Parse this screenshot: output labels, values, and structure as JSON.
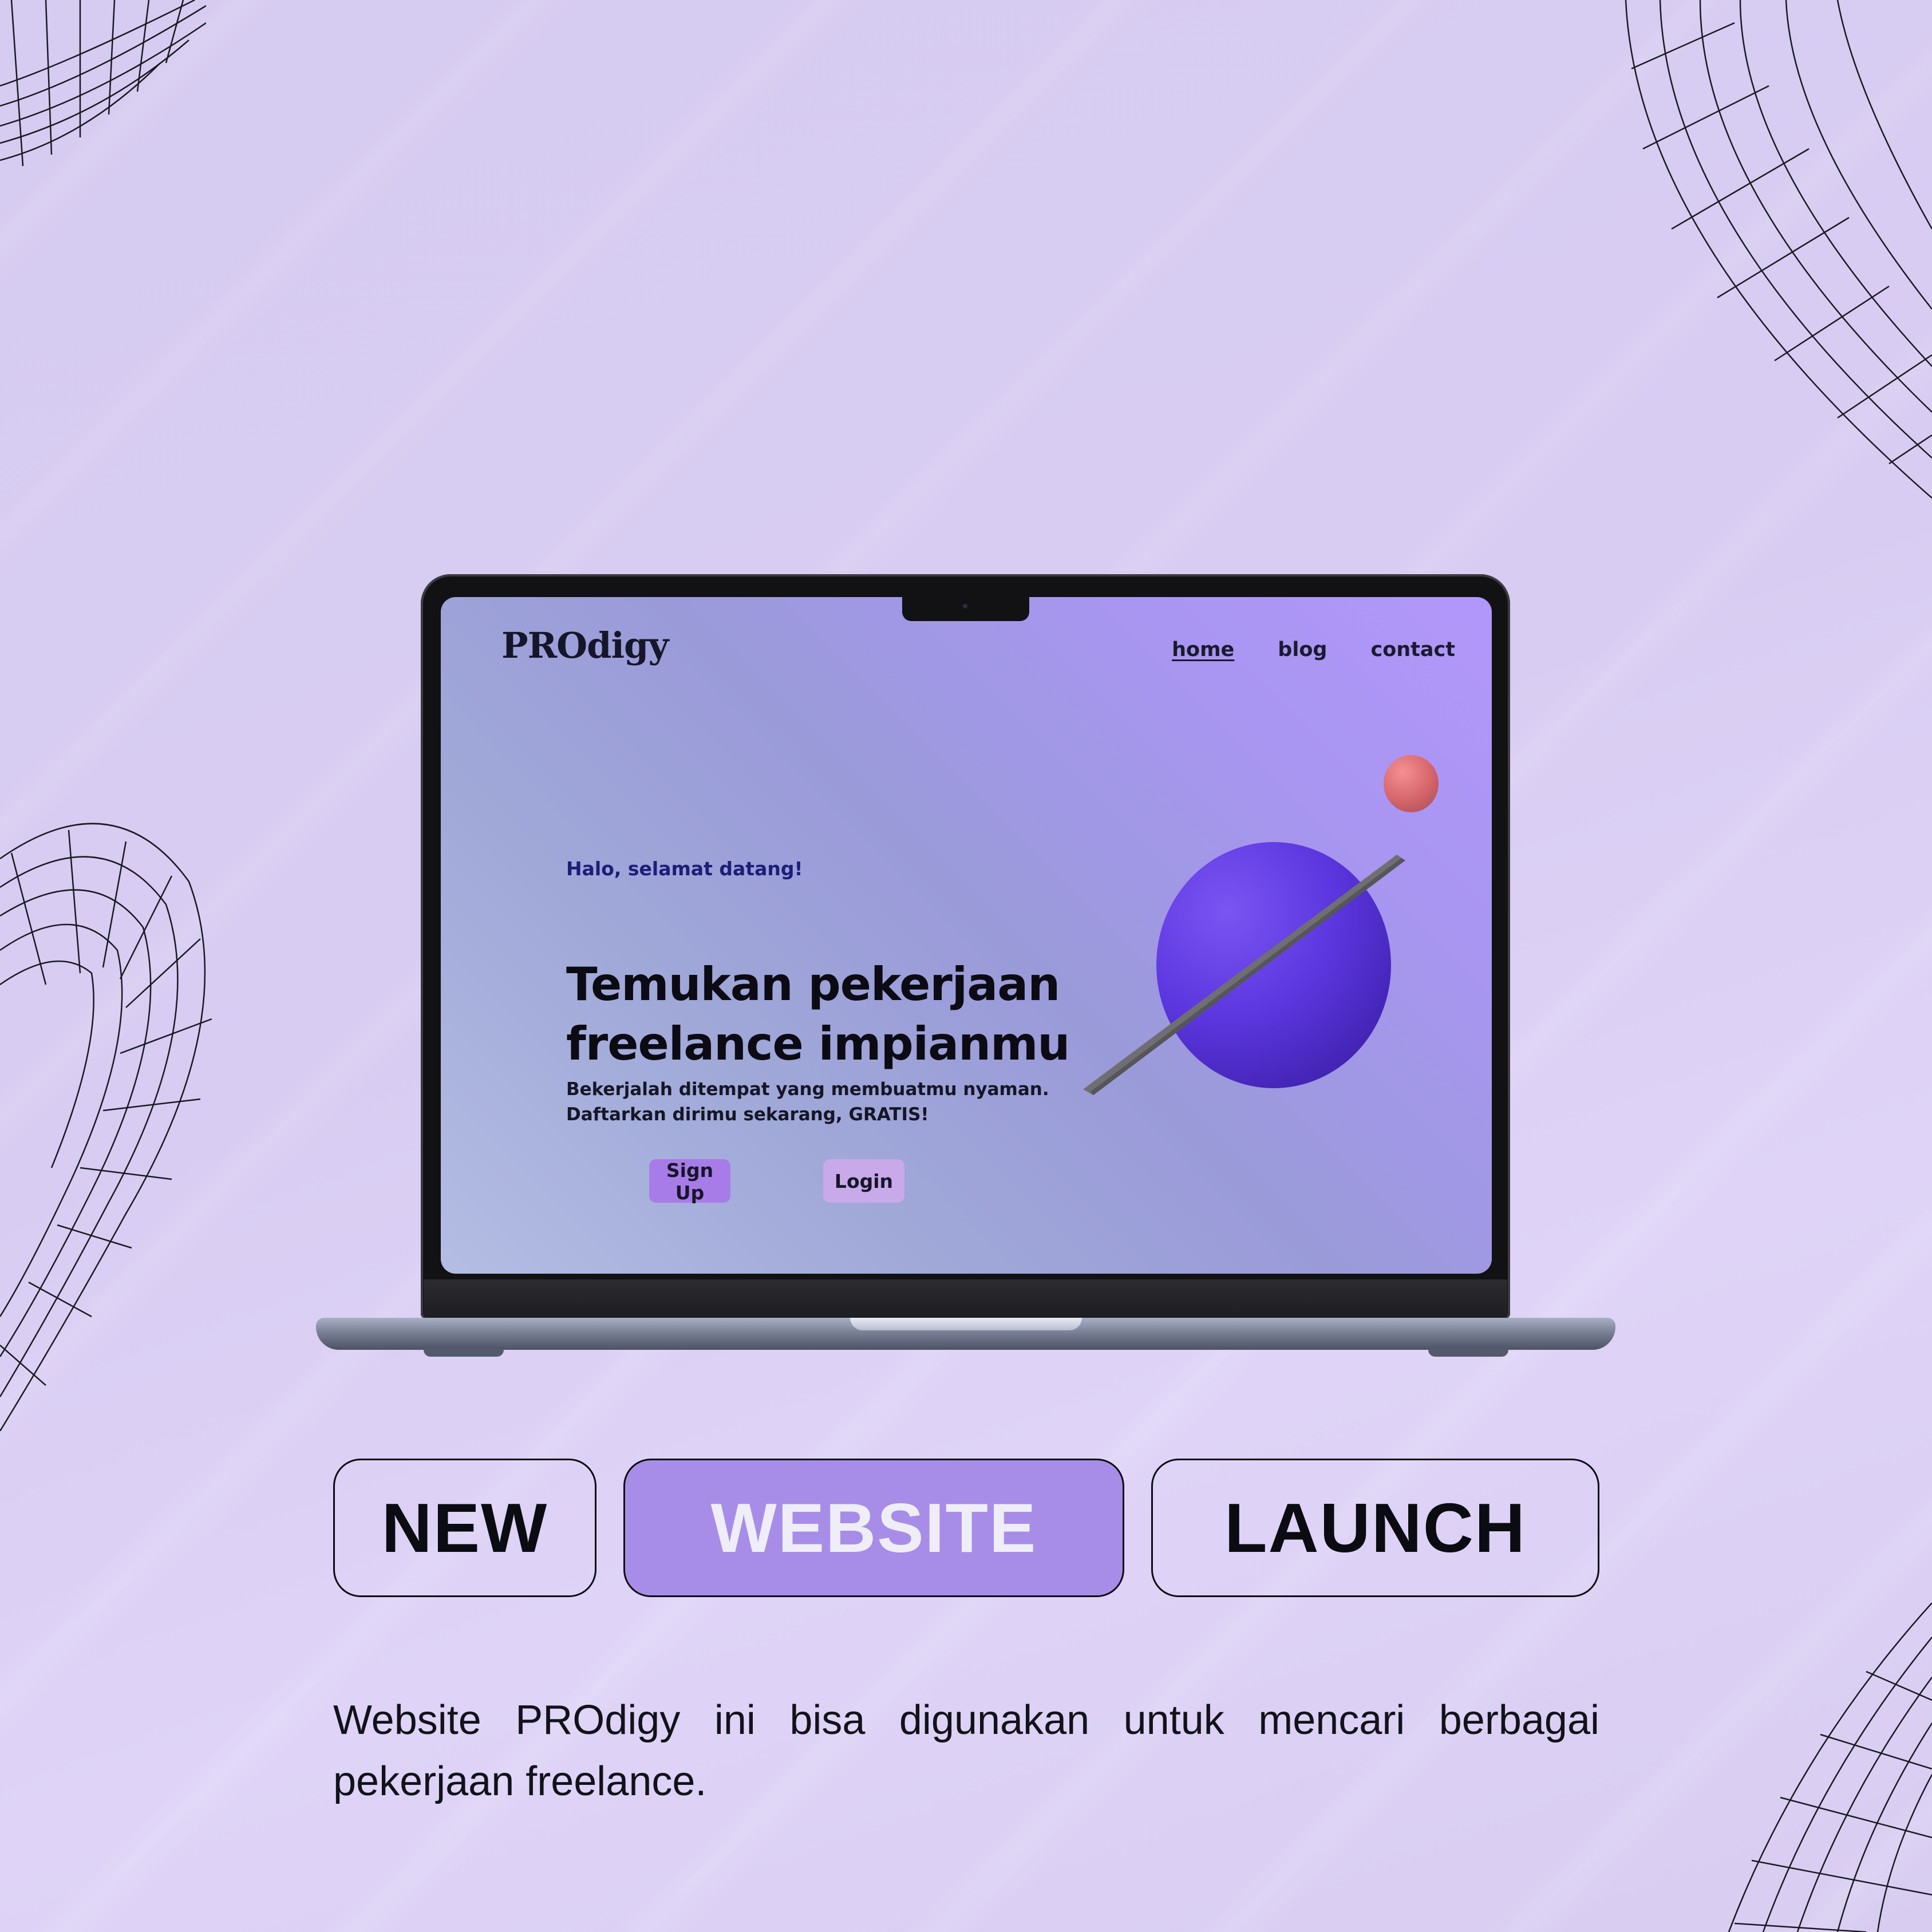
{
  "colors": {
    "background": "#d7ccf1",
    "accent": "#a88de8",
    "planet": "#5b36df",
    "moon": "#d46469",
    "signup_button": "#a77ce8",
    "login_button": "#c8a9ea"
  },
  "site": {
    "logo": "PROdigy",
    "nav": {
      "home": "home",
      "blog": "blog",
      "contact": "contact"
    },
    "greeting": "Halo, selamat datang!",
    "headline_line1": "Temukan pekerjaan",
    "headline_line2": "freelance impianmu",
    "subtext_line1": "Bekerjalah ditempat yang membuatmu nyaman.",
    "subtext_line2": "Daftarkan dirimu sekarang, GRATIS!",
    "signup_label": "Sign Up",
    "login_label": "Login"
  },
  "tags": {
    "new": "NEW",
    "website": "WEBSITE",
    "launch": "LAUNCH"
  },
  "description": "Website PROdigy ini bisa digunakan untuk mencari berbagai pekerjaan freelance."
}
